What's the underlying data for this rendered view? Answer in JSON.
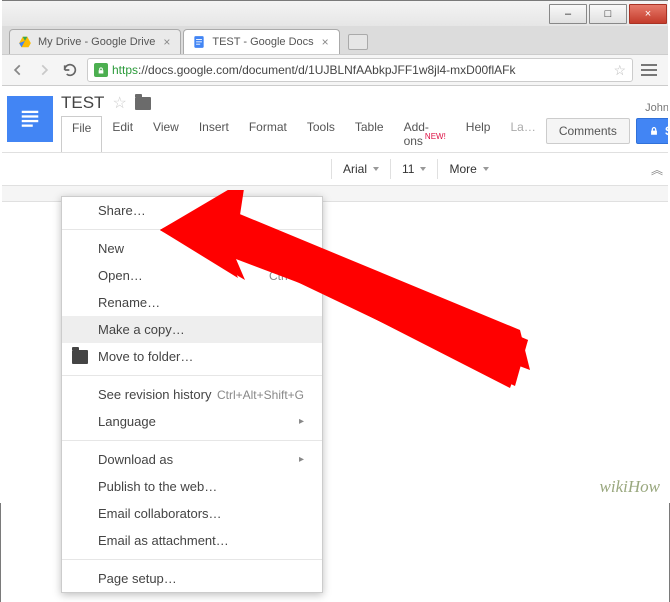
{
  "window": {
    "minimize": "–",
    "maximize": "□",
    "close": "×"
  },
  "tabs": [
    {
      "title": "My Drive - Google Drive"
    },
    {
      "title": "TEST - Google Docs"
    }
  ],
  "address": {
    "secure": "https",
    "rest": "://docs.google.com/document/d/1UJBLNfAAbkpJFF1w8jl4-mxD00flAFk"
  },
  "docs": {
    "doc_title": "TEST",
    "user": "John Smith",
    "comments_label": "Comments",
    "share_label": "Share",
    "menus": {
      "file": "File",
      "edit": "Edit",
      "view": "View",
      "insert": "Insert",
      "format": "Format",
      "tools": "Tools",
      "table": "Table",
      "addons": "Add-ons",
      "addons_badge": "NEW!",
      "help": "Help",
      "last": "La…"
    },
    "toolbar": {
      "font": "Arial",
      "size": "11",
      "more": "More"
    }
  },
  "file_menu": {
    "share": "Share…",
    "new": "New",
    "open": "Open…",
    "open_shortcut": "Ctrl+O",
    "rename": "Rename…",
    "make_a_copy": "Make a copy…",
    "move_to_folder": "Move to folder…",
    "revision": "See revision history",
    "revision_shortcut": "Ctrl+Alt+Shift+G",
    "language": "Language",
    "download_as": "Download as",
    "publish": "Publish to the web…",
    "email_collab": "Email collaborators…",
    "email_attach": "Email as attachment…",
    "page_setup": "Page setup…"
  },
  "watermark": "wikiHow"
}
